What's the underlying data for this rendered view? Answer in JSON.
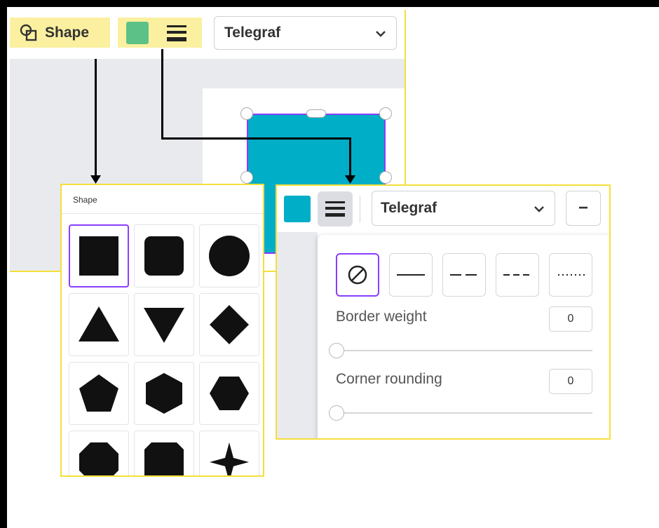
{
  "editor": {
    "toolbar": {
      "shape_button_label": "Shape",
      "font_name": "Telegraf"
    },
    "colors": {
      "highlight": "#faf0a0",
      "fill_swatch": "#5cc186",
      "shape_fill": "#00aec7",
      "selection": "#8b3dff"
    }
  },
  "shape_panel": {
    "title": "Shape",
    "shapes": [
      "square",
      "rounded-square",
      "circle",
      "triangle",
      "inverted-triangle",
      "diamond",
      "pentagon",
      "hexagon",
      "hexagon-flat",
      "octagon",
      "cut-corner-square",
      "four-point-star"
    ],
    "selected": "square"
  },
  "border_panel": {
    "font_name": "Telegraf",
    "minus_label": "−",
    "border_styles": [
      "none",
      "solid",
      "long-dash",
      "dash",
      "dotted"
    ],
    "selected_style": "none",
    "border_weight": {
      "label": "Border weight",
      "value": "0"
    },
    "corner_rounding": {
      "label": "Corner rounding",
      "value": "0"
    }
  }
}
